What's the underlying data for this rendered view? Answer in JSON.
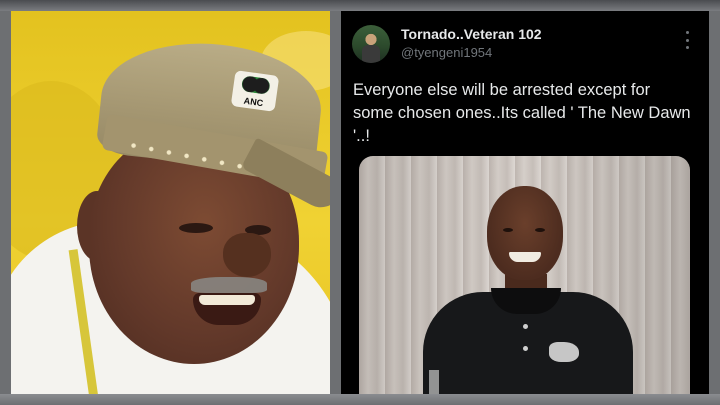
{
  "left_photo": {
    "cap_badge_text": "ANC"
  },
  "tweet": {
    "display_name": "Tornado..Veteran 102",
    "handle": "@tyengeni1954",
    "text": "Everyone else will be arrested except for some chosen ones..Its called ' The New Dawn '..!",
    "more_icon": "more-vertical-icon"
  },
  "colors": {
    "tweet_background": "#000000",
    "name_text": "#e7e9ea",
    "handle_text": "#71767b",
    "left_background": "#f0d233"
  }
}
